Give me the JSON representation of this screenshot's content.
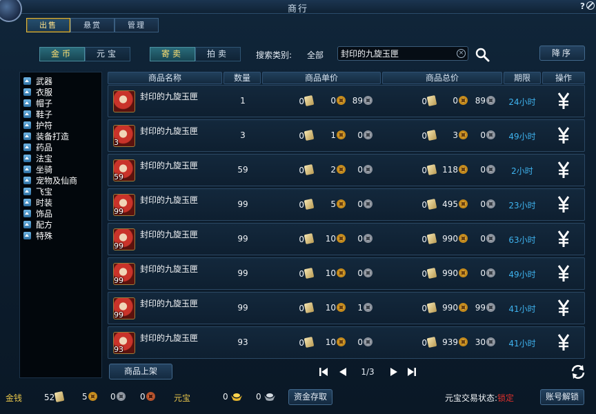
{
  "window": {
    "title": "商行",
    "help": "?"
  },
  "tabs": [
    {
      "label": "出售",
      "active": true
    },
    {
      "label": "悬赏",
      "active": false
    },
    {
      "label": "管理",
      "active": false
    }
  ],
  "currency_toggle": [
    {
      "label": "金币",
      "active": true
    },
    {
      "label": "元宝",
      "active": false
    }
  ],
  "mode_toggle": [
    {
      "label": "寄卖",
      "active": true
    },
    {
      "label": "拍卖",
      "active": false
    }
  ],
  "search": {
    "label": "搜索类别:",
    "category": "全部",
    "value": "封印的九旋玉匣",
    "clear_icon": "×"
  },
  "sort_button": "降序",
  "categories": [
    "武器",
    "衣服",
    "帽子",
    "鞋子",
    "护符",
    "装备打造",
    "药品",
    "法宝",
    "坐骑",
    "宠物及仙商",
    "飞宝",
    "时装",
    "饰品",
    "配方",
    "特殊"
  ],
  "columns": {
    "name": "商品名称",
    "qty": "数量",
    "unit_price": "商品单价",
    "total_price": "商品总价",
    "duration": "期限",
    "action": "操作"
  },
  "rows": [
    {
      "name": "封印的九旋玉匣",
      "badge": "",
      "qty": "1",
      "unit": [
        "0",
        "0",
        "89"
      ],
      "total": [
        "0",
        "0",
        "89"
      ],
      "duration": "24小时"
    },
    {
      "name": "封印的九旋玉匣",
      "badge": "3",
      "qty": "3",
      "unit": [
        "0",
        "1",
        "0"
      ],
      "total": [
        "0",
        "3",
        "0"
      ],
      "duration": "49小时"
    },
    {
      "name": "封印的九旋玉匣",
      "badge": "59",
      "qty": "59",
      "unit": [
        "0",
        "2",
        "0"
      ],
      "total": [
        "0",
        "118",
        "0"
      ],
      "duration": "2小时"
    },
    {
      "name": "封印的九旋玉匣",
      "badge": "99",
      "qty": "99",
      "unit": [
        "0",
        "5",
        "0"
      ],
      "total": [
        "0",
        "495",
        "0"
      ],
      "duration": "23小时"
    },
    {
      "name": "封印的九旋玉匣",
      "badge": "99",
      "qty": "99",
      "unit": [
        "0",
        "10",
        "0"
      ],
      "total": [
        "0",
        "990",
        "0"
      ],
      "duration": "63小时"
    },
    {
      "name": "封印的九旋玉匣",
      "badge": "99",
      "qty": "99",
      "unit": [
        "0",
        "10",
        "0"
      ],
      "total": [
        "0",
        "990",
        "0"
      ],
      "duration": "49小时"
    },
    {
      "name": "封印的九旋玉匣",
      "badge": "99",
      "qty": "99",
      "unit": [
        "0",
        "10",
        "1"
      ],
      "total": [
        "0",
        "990",
        "99"
      ],
      "duration": "41小时"
    },
    {
      "name": "封印的九旋玉匣",
      "badge": "93",
      "qty": "93",
      "unit": [
        "0",
        "10",
        "0"
      ],
      "total": [
        "0",
        "939",
        "30"
      ],
      "duration": "41小时"
    }
  ],
  "list_button": "商品上架",
  "pager": {
    "current": "1/3"
  },
  "footer": {
    "money_label": "金钱",
    "money_paper": "52",
    "money_gold": "5",
    "money_silver": "0",
    "money_copper": "0",
    "yuanbao_label": "元宝",
    "yuanbao_gold": "0",
    "yuanbao_silver": "0",
    "deposit_button": "资金存取",
    "trade_status_label": "元宝交易状态:",
    "trade_status_value": "锁定",
    "unlock_button": "账号解锁"
  },
  "colors": {
    "accent_gold": "#ffe28a",
    "duration_blue": "#3fb3ef",
    "locked_red": "#e0302c"
  },
  "icons": {
    "buy": "yen-icon",
    "search": "magnifier-icon",
    "refresh": "refresh-icon",
    "item": "gift-box-icon"
  }
}
